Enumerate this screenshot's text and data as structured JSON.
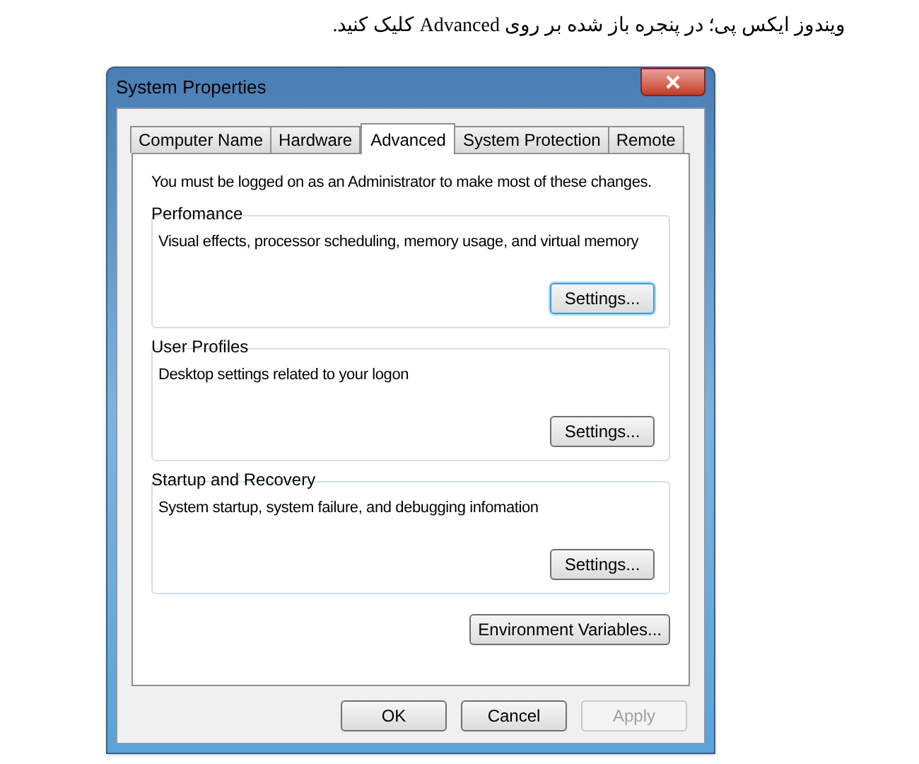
{
  "caption": "ویندوز ایکس پی؛ در پنجره باز شده بر روی Advanced کلیک کنید.",
  "window": {
    "title": "System Properties"
  },
  "tabs": [
    {
      "label": "Computer Name",
      "selected": false
    },
    {
      "label": "Hardware",
      "selected": false
    },
    {
      "label": "Advanced",
      "selected": true
    },
    {
      "label": "System Protection",
      "selected": false
    },
    {
      "label": "Remote",
      "selected": false
    }
  ],
  "notice": "You must be logged on as an Administrator to make most of these changes.",
  "groups": [
    {
      "title": "Perfomance",
      "description": "Visual effects, processor scheduling, memory usage, and virtual memory",
      "button": "Settings...",
      "focused": true
    },
    {
      "title": "User Profiles",
      "description": "Desktop settings related to your logon",
      "button": "Settings...",
      "focused": false
    },
    {
      "title": "Startup and Recovery",
      "description": "System startup, system failure, and debugging infomation",
      "button": "Settings...",
      "focused": false
    }
  ],
  "environment_button": "Environment Variables...",
  "buttons": [
    {
      "label": "OK",
      "disabled": false
    },
    {
      "label": "Cancel",
      "disabled": false
    },
    {
      "label": "Apply",
      "disabled": true
    }
  ]
}
